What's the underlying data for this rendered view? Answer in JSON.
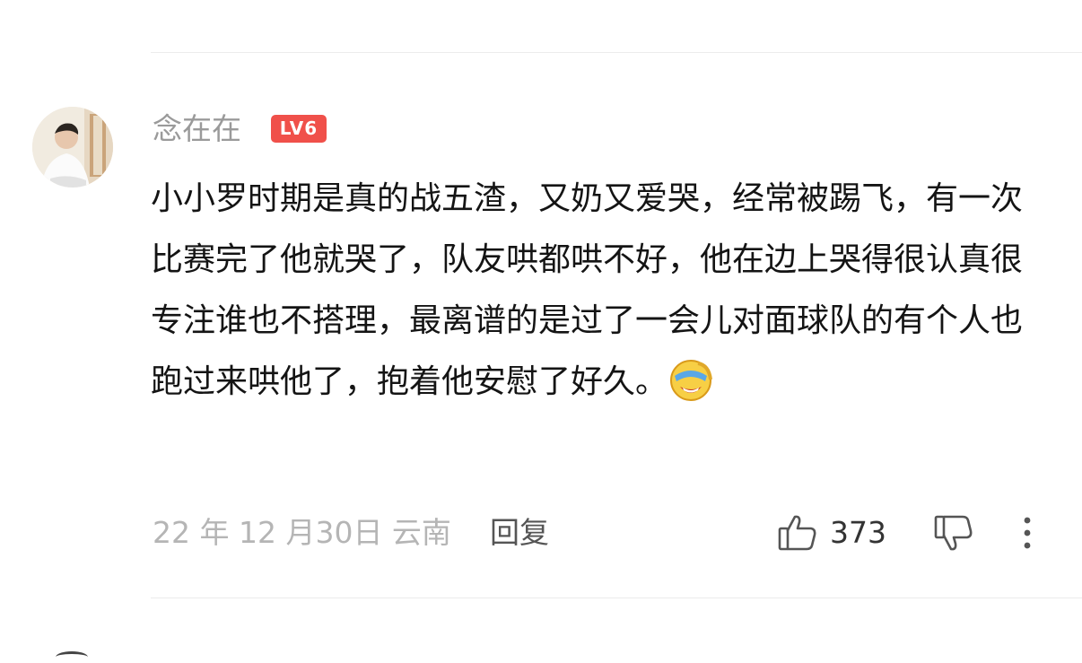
{
  "comment": {
    "username": "念在在",
    "level_badge": "LV6",
    "text": "小小罗时期是真的战五渣，又奶又爱哭，经常被踢飞，有一次比赛完了他就哭了，队友哄都哄不好，他在边上哭得很认真很专注谁也不搭理，最离谱的是过了一会儿对面球队的有个人也跑过来哄他了，抱着他安慰了好久。",
    "emoji": "laugh-cry-emoji",
    "date_location": "22 年 12 月30日 云南",
    "reply_label": "回复",
    "like_count": "373"
  },
  "icons": {
    "like": "thumbs-up-icon",
    "dislike": "thumbs-down-icon",
    "more": "more-vertical-icon"
  },
  "colors": {
    "level_badge": "#f0504a",
    "username": "#9a9a9a",
    "meta": "#b5b5b5"
  }
}
